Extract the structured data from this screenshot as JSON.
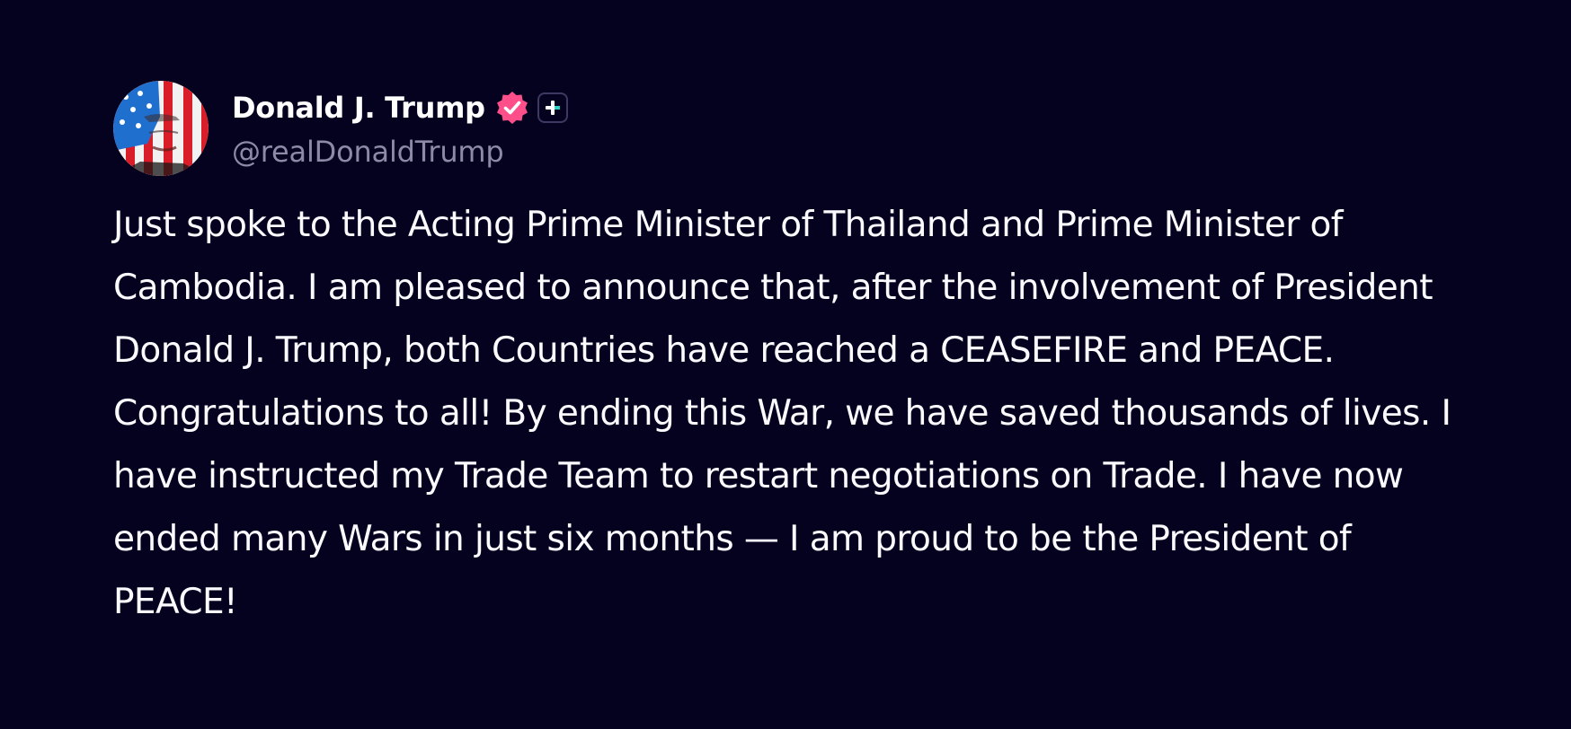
{
  "author": {
    "display_name": "Donald J. Trump",
    "handle": "@realDonaldTrump",
    "avatar_icon": "flag-face-avatar",
    "verified_icon": "verified-badge-icon",
    "verified_color": "#ff4f8b",
    "plus_icon": "plus-badge-icon"
  },
  "post": {
    "text": "Just spoke to the Acting Prime Minister of Thailand and Prime Minister of Cambodia. I am pleased to announce that, after the involvement of President Donald J. Trump, both Countries have reached a CEASEFIRE and PEACE. Congratulations to all! By ending this War, we have saved thousands of lives. I have instructed my Trade Team to restart negotiations on Trade. I have now ended many Wars in just six months — I am proud to be the President of PEACE!"
  },
  "colors": {
    "background": "#04021f",
    "text": "#ffffff",
    "handle": "#8d8aa6"
  }
}
